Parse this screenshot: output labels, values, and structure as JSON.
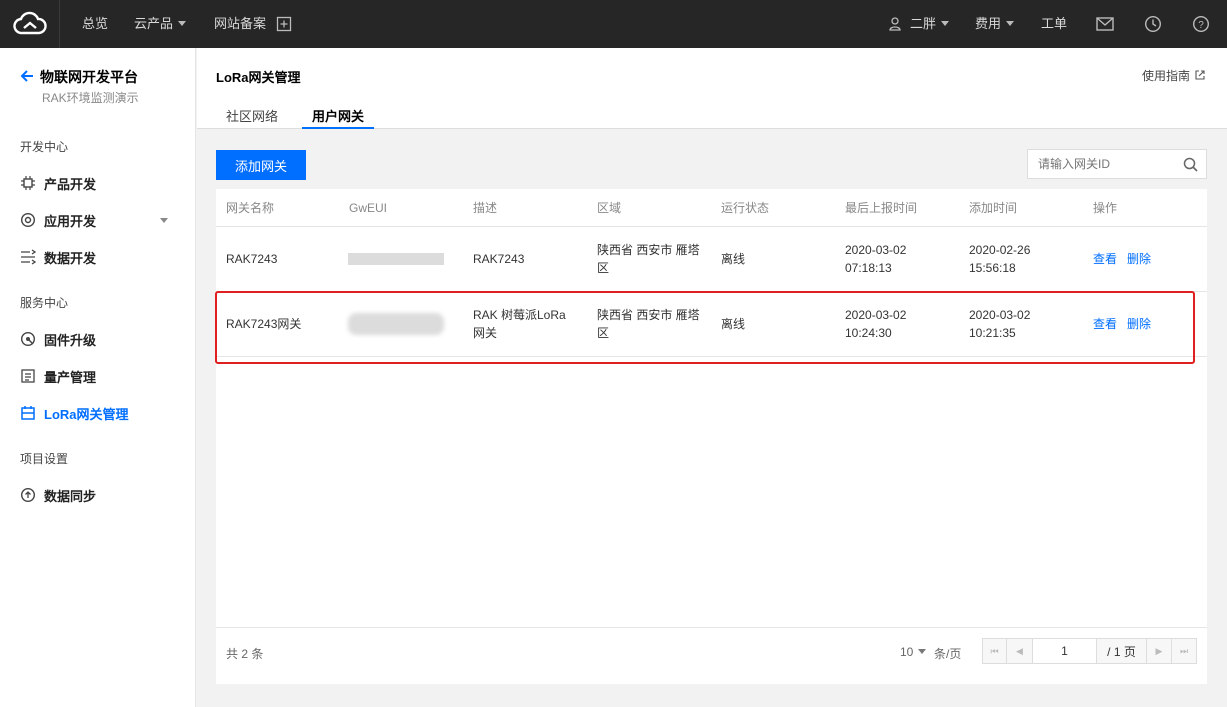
{
  "topbar": {
    "items": [
      "总览",
      "云产品",
      "网站备案"
    ],
    "user": "二胖",
    "fee": "费用",
    "ticket": "工单"
  },
  "sidebar": {
    "title": "物联网开发平台",
    "subtitle": "RAK环境监测演示",
    "sections": [
      "开发中心",
      "服务中心",
      "项目设置"
    ],
    "items": [
      {
        "label": "产品开发",
        "icon": "chip-icon"
      },
      {
        "label": "应用开发",
        "icon": "gear-icon"
      },
      {
        "label": "数据开发",
        "icon": "flow-icon"
      },
      {
        "label": "固件升级",
        "icon": "upgrade-icon"
      },
      {
        "label": "量产管理",
        "icon": "list-icon"
      },
      {
        "label": "LoRa网关管理",
        "icon": "gateway-icon"
      },
      {
        "label": "数据同步",
        "icon": "sync-icon"
      }
    ]
  },
  "header": {
    "title": "LoRa网关管理",
    "guide": "使用指南",
    "tabs": [
      "社区网络",
      "用户网关"
    ],
    "active_tab": "用户网关"
  },
  "toolbar": {
    "add_label": "添加网关",
    "search_placeholder": "请输入网关ID"
  },
  "table": {
    "columns": [
      "网关名称",
      "GwEUI",
      "描述",
      "区域",
      "运行状态",
      "最后上报时间",
      "添加时间",
      "操作"
    ],
    "rows": [
      {
        "name": "RAK7243",
        "desc1": "RAK7243",
        "desc2": "",
        "region1": "陕西省 西安市 雁塔",
        "region2": "区",
        "status": "离线",
        "last1": "2020-03-02",
        "last2": "07:18:13",
        "add1": "2020-02-26",
        "add2": "15:56:18",
        "view": "查看",
        "delete": "删除"
      },
      {
        "name": "RAK7243网关",
        "desc1": "RAK 树莓派LoRa",
        "desc2": "网关",
        "region1": "陕西省 西安市 雁塔",
        "region2": "区",
        "status": "离线",
        "last1": "2020-03-02",
        "last2": "10:24:30",
        "add1": "2020-03-02",
        "add2": "10:21:35",
        "view": "查看",
        "delete": "删除"
      }
    ]
  },
  "pager": {
    "total": "共 2 条",
    "size": "10",
    "per_page": "条/页",
    "page": "1",
    "pages": "/ 1 页"
  }
}
